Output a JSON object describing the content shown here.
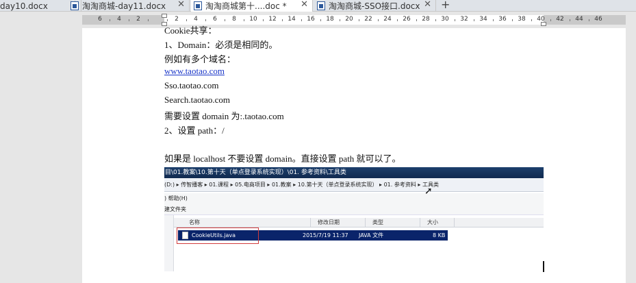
{
  "tabs": [
    {
      "label": "day10.docx",
      "active": false
    },
    {
      "label": "淘淘商城-day11.docx",
      "active": false
    },
    {
      "label": "淘淘商城第十....doc *",
      "active": true
    },
    {
      "label": "淘淘商城-SSO接口.docx",
      "active": false
    }
  ],
  "tab_close_glyph": "✕",
  "new_tab_glyph": "+",
  "ruler": {
    "numbers": [
      "6",
      "4",
      "2",
      "",
      "2",
      "4",
      "6",
      "8",
      "10",
      "12",
      "14",
      "16",
      "18",
      "20",
      "22",
      "24",
      "26",
      "28",
      "30",
      "32",
      "34",
      "36",
      "38",
      "40",
      "42",
      "44",
      "46"
    ]
  },
  "document": {
    "lines": [
      {
        "text": "Cookie共享：",
        "link": false
      },
      {
        "text": "1、Domain：必须是相同的。",
        "link": false
      },
      {
        "text": "例如有多个域名：",
        "link": false
      },
      {
        "text": "www.taotao.com",
        "link": true
      },
      {
        "text": "Sso.taotao.com",
        "link": false
      },
      {
        "text": "Search.taotao.com",
        "link": false
      },
      {
        "text": "需要设置 domain 为:.taotao.com",
        "link": false
      },
      {
        "text": "2、设置 path：/",
        "link": false
      },
      {
        "text": "",
        "link": false
      },
      {
        "text": "如果是 localhost 不要设置 domain。直接设置 path 就可以了。",
        "link": false
      }
    ]
  },
  "explorer": {
    "title": "目\\01.教案\\10.第十天（单点登录系统实现）\\01. 参考资料\\工具类",
    "address": "(D:) ▸ 传智播客 ▸ 01.课程 ▸ 05.电商项目 ▸ 01.教案 ▸ 10.第十天（单点登录系统实现） ▸ 01. 参考资料 ▸ 工具类",
    "menu": ")  帮助(H)",
    "toolbar": "建文件夹",
    "columns": [
      "名称",
      "修改日期",
      "类型",
      "大小"
    ],
    "file": {
      "name": "CookieUtils.java",
      "date": "2015/7/19 11:37",
      "type": "JAVA 文件",
      "size": "8 KB"
    }
  }
}
